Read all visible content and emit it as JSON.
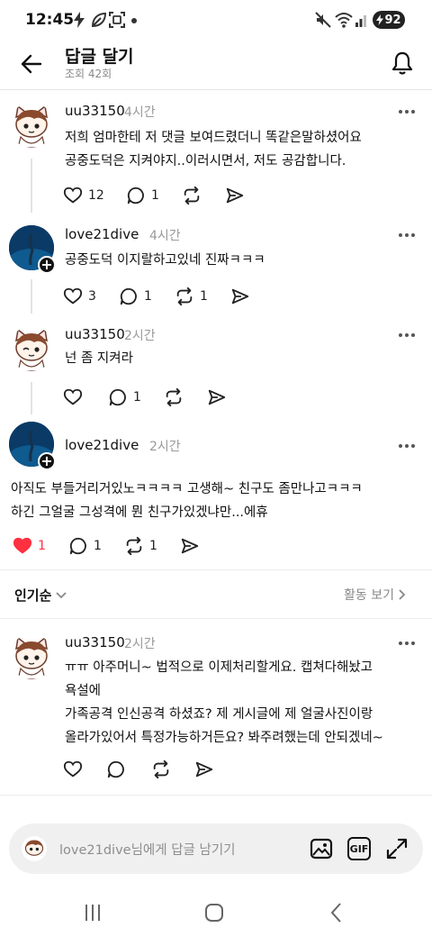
{
  "status_bar": {
    "time": "12:45",
    "battery": "92"
  },
  "header": {
    "title": "답글 달기",
    "views": "조회 42회"
  },
  "comments": [
    {
      "username": "uu33150",
      "time": "4시간",
      "text": "저희 엄마한테 저 댓글 보여드렸더니 똑같은말하셨어요\n공중도덕은 지켜야지..이러시면서, 저도 공감합니다.",
      "likes": "12",
      "replies": "1",
      "reposts": "",
      "liked": false
    },
    {
      "username": "love21dive",
      "time": "4시간",
      "text": "공중도덕 이지랄하고있네 진짜ㅋㅋㅋ",
      "likes": "3",
      "replies": "1",
      "reposts": "1",
      "liked": false
    },
    {
      "username": "uu33150",
      "time": "2시간",
      "text": "넌 좀 지켜라",
      "likes": "",
      "replies": "1",
      "reposts": "",
      "liked": false
    },
    {
      "username": "love21dive",
      "time": "2시간",
      "text": "아직도 부들거리거있노ㅋㅋㅋㅋ 고생해~ 친구도 좀만나고ㅋㅋㅋ\n하긴 그얼굴 그성격에 뭔 친구가있겠냐만...에휴",
      "likes": "1",
      "replies": "1",
      "reposts": "1",
      "liked": true
    },
    {
      "username": "uu33150",
      "time": "2시간",
      "text": "ㅠㅠ 아주머니~ 법적으로 이제처리할게요. 캡쳐다해놨고\n욕설에\n가족공격 인신공격 하셨죠? 제 게시글에 제 얼굴사진이랑\n올라가있어서 특정가능하거든요? 봐주려했는데 안되겠네~",
      "likes": "",
      "replies": "",
      "reposts": "",
      "liked": false
    }
  ],
  "sort": {
    "label": "인기순"
  },
  "activity": {
    "label": "활동 보기"
  },
  "composer": {
    "placeholder": "love21dive님에게 답글 남기기",
    "gif_label": "GIF"
  },
  "colors": {
    "like_active": "#ff3040",
    "text": "#111111",
    "muted": "#999999"
  }
}
